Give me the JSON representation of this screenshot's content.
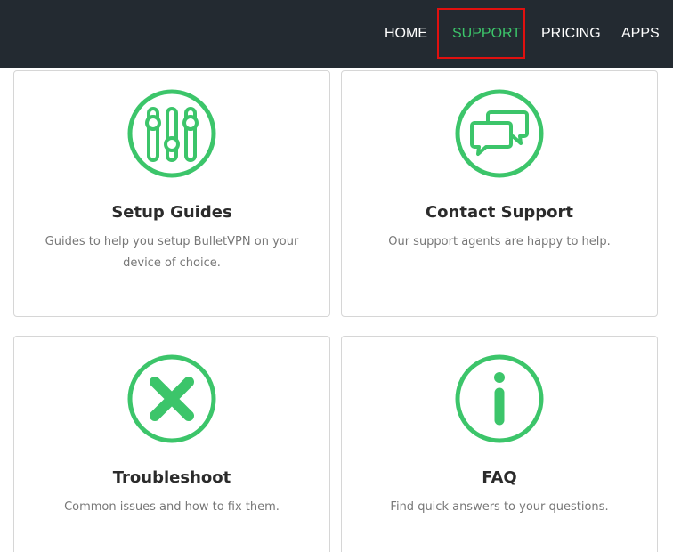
{
  "nav": {
    "home": "HOME",
    "support": "SUPPORT",
    "pricing": "PRICING",
    "apps": "APPS"
  },
  "colors": {
    "accent": "#3cc56a",
    "topbar": "#232a31",
    "highlight": "#e0100f"
  },
  "cards": [
    {
      "title": "Setup Guides",
      "description": "Guides to help you setup BulletVPN on your device of choice.",
      "icon": "sliders-icon"
    },
    {
      "title": "Contact Support",
      "description": "Our support agents are happy to help.",
      "icon": "chat-bubbles-icon"
    },
    {
      "title": "Troubleshoot",
      "description": "Common issues and how to fix them.",
      "icon": "close-x-icon"
    },
    {
      "title": "FAQ",
      "description": "Find quick answers to your questions.",
      "icon": "info-icon"
    }
  ]
}
